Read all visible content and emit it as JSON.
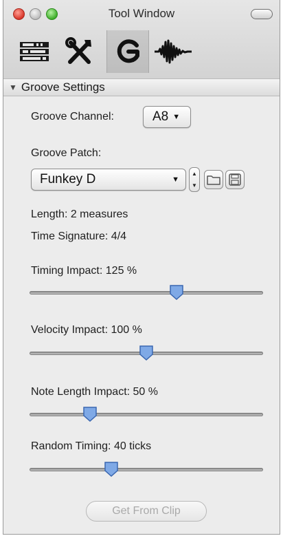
{
  "window": {
    "title": "Tool Window"
  },
  "toolbar": {
    "buttons": [
      {
        "icon": "rack-icon"
      },
      {
        "icon": "tools-icon"
      },
      {
        "icon": "groove-icon",
        "selected": true
      },
      {
        "icon": "waveform-icon"
      }
    ]
  },
  "section": {
    "title": "Groove Settings",
    "arrow": "▼"
  },
  "groove_channel": {
    "label": "Groove Channel:",
    "value": "A8"
  },
  "groove_patch": {
    "label": "Groove Patch:",
    "value": "Funkey D"
  },
  "info": {
    "length": "Length: 2 measures",
    "time_signature": "Time Signature: 4/4"
  },
  "sliders": [
    {
      "label": "Timing Impact: 125 %",
      "position": 0.63
    },
    {
      "label": "Velocity Impact: 100 %",
      "position": 0.5
    },
    {
      "label": "Note Length Impact: 50 %",
      "position": 0.26
    },
    {
      "label": "Random Timing: 40 ticks",
      "position": 0.35
    }
  ],
  "actions": {
    "get_from_clip": "Get From Clip"
  },
  "colors": {
    "thumb_fill": "#7fa9e6",
    "thumb_stroke": "#3a67b0",
    "close": "#e0443a",
    "minimize": "#c4c4c4",
    "zoom": "#4bbd3a"
  }
}
